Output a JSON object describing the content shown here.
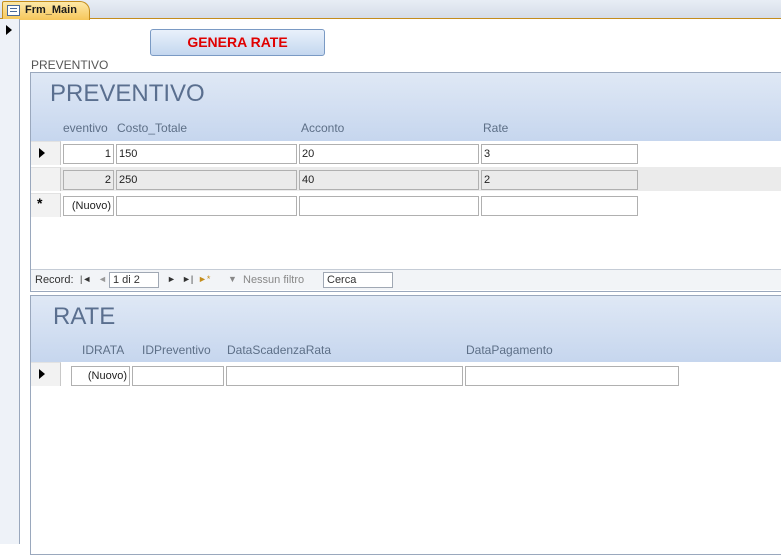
{
  "tab": {
    "label": "Frm_Main",
    "icon": "form-icon"
  },
  "main": {
    "generate_button": "GENERA RATE",
    "section_label": "PREVENTIVO"
  },
  "preventivo": {
    "title": "PREVENTIVO",
    "columns": [
      "eventivo",
      "Costo_Totale",
      "Acconto",
      "Rate"
    ],
    "rows": [
      {
        "id": "1",
        "costo": "150",
        "acconto": "20",
        "rate": "3"
      },
      {
        "id": "2",
        "costo": "250",
        "acconto": "40",
        "rate": "2"
      }
    ],
    "new_row_label": "(Nuovo)",
    "nav": {
      "record_label": "Record:",
      "position": "1 di 2",
      "filter_label": "Nessun filtro",
      "search_placeholder": "Cerca"
    }
  },
  "rate": {
    "title": "RATE",
    "columns": [
      "IDRATA",
      "IDPreventivo",
      "DataScadenzaRata",
      "DataPagamento"
    ],
    "new_row_label": "(Nuovo)"
  },
  "colors": {
    "accent": "#e00000",
    "header": "#c6d6ee",
    "tab": "#f6c65a"
  }
}
